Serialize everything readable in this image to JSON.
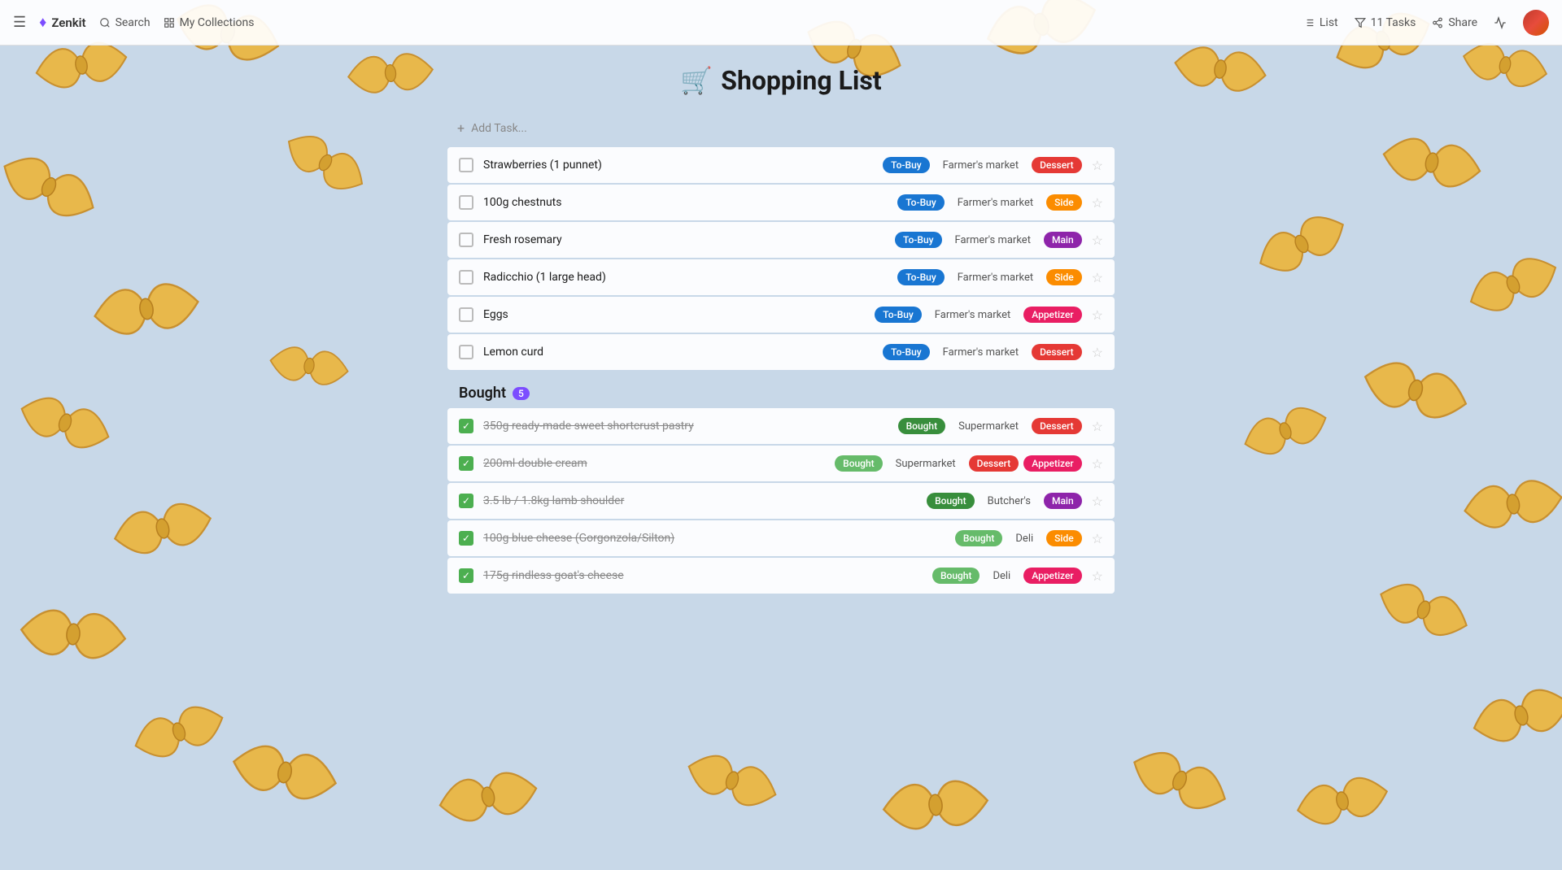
{
  "brand": {
    "name": "Zenkit",
    "gem": "♦"
  },
  "navbar": {
    "hamburger": "☰",
    "search_label": "Search",
    "collections_label": "My Collections",
    "list_label": "List",
    "tasks_label": "11 Tasks",
    "share_label": "Share",
    "activity_icon": "activity-icon"
  },
  "page": {
    "title": "Shopping List",
    "cart_icon": "🛒"
  },
  "add_task": {
    "label": "Add Task...",
    "plus": "+"
  },
  "to_buy_items": [
    {
      "name": "Strawberries (1 punnet)",
      "status": "To-Buy",
      "location": "Farmer's market",
      "category": "Dessert",
      "category_class": "tag-dessert",
      "checked": false
    },
    {
      "name": "100g chestnuts",
      "status": "To-Buy",
      "location": "Farmer's market",
      "category": "Side",
      "category_class": "tag-side",
      "checked": false
    },
    {
      "name": "Fresh rosemary",
      "status": "To-Buy",
      "location": "Farmer's market",
      "category": "Main",
      "category_class": "tag-main",
      "checked": false
    },
    {
      "name": "Radicchio (1 large head)",
      "status": "To-Buy",
      "location": "Farmer's market",
      "category": "Side",
      "category_class": "tag-side",
      "checked": false
    },
    {
      "name": "Eggs",
      "status": "To-Buy",
      "location": "Farmer's market",
      "category": "Appetizer",
      "category_class": "tag-appetizer",
      "checked": false
    },
    {
      "name": "Lemon curd",
      "status": "To-Buy",
      "location": "Farmer's market",
      "category": "Dessert",
      "category_class": "tag-dessert",
      "checked": false
    }
  ],
  "bought_section": {
    "label": "Bought",
    "count": "5"
  },
  "bought_items": [
    {
      "name": "350g ready-made sweet shortcrust pastry",
      "status": "Bought",
      "status_class": "tag-bought-dark",
      "location": "Supermarket",
      "category": "Dessert",
      "category_class": "tag-dessert",
      "checked": true
    },
    {
      "name": "200ml double cream",
      "status": "Bought",
      "status_class": "tag-bought-light",
      "location": "Supermarket",
      "category": "Appetizer",
      "category_class": "tag-appetizer",
      "extra_category": "Dessert",
      "extra_category_class": "tag-dessert",
      "checked": true
    },
    {
      "name": "3.5 lb / 1.8kg lamb shoulder",
      "status": "Bought",
      "status_class": "tag-bought-dark",
      "location": "Butcher's",
      "category": "Main",
      "category_class": "tag-main",
      "checked": true
    },
    {
      "name": "100g blue cheese (Gorgonzola/Silton)",
      "status": "Bought",
      "status_class": "tag-bought-light",
      "location": "Deli",
      "category": "Side",
      "category_class": "tag-side",
      "checked": true
    },
    {
      "name": "175g rindless goat's cheese",
      "status": "Bought",
      "status_class": "tag-bought-light",
      "location": "Deli",
      "category": "Appetizer",
      "category_class": "tag-appetizer",
      "checked": true
    }
  ]
}
